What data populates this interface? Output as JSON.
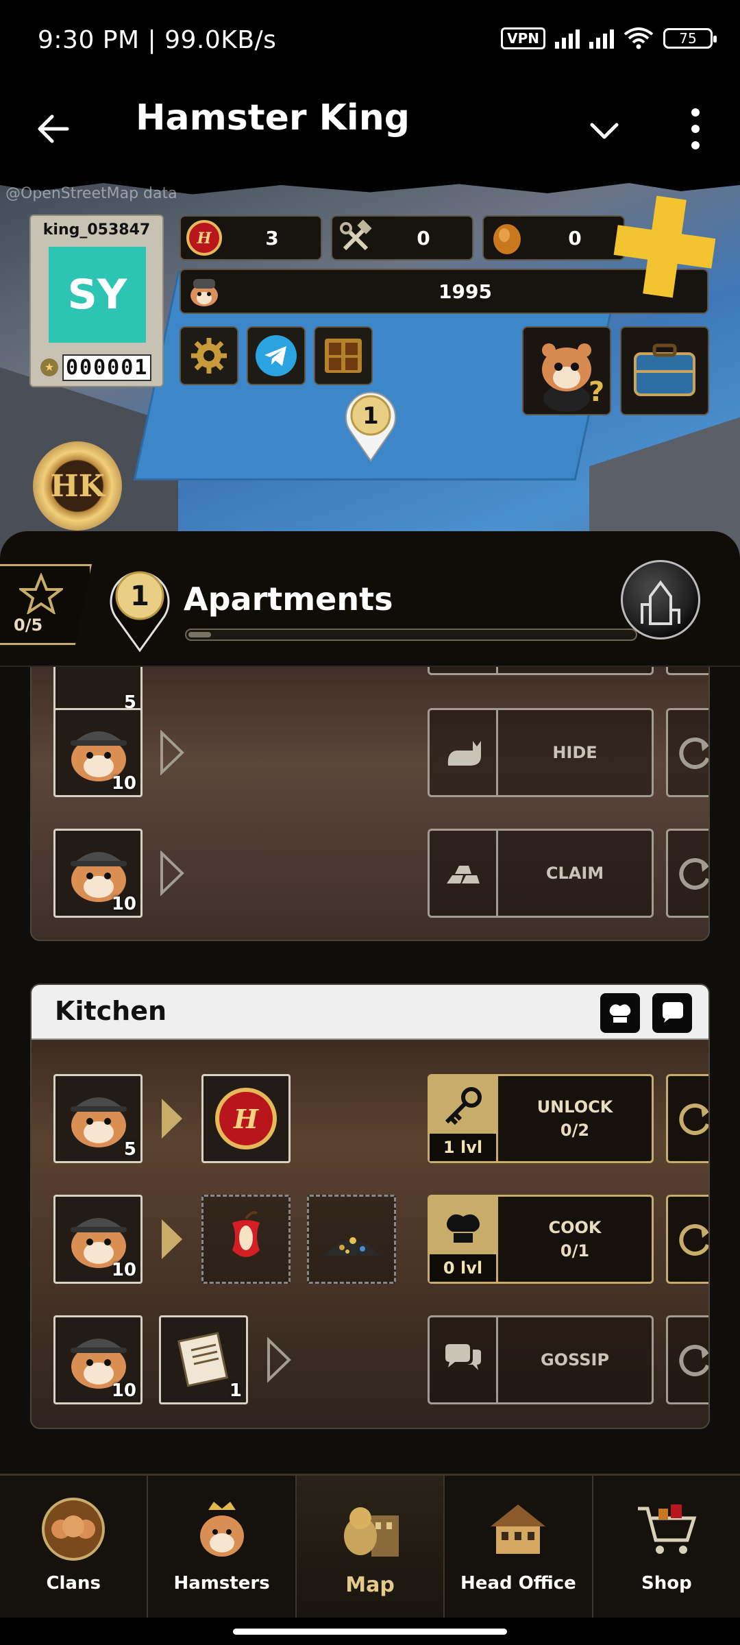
{
  "status_bar": {
    "time": "9:30 PM | 99.0KB/s",
    "vpn": "VPN",
    "battery": "75"
  },
  "app_bar": {
    "title": "Hamster King"
  },
  "map": {
    "attribution": "@OpenStreetMap data",
    "pin_number": "1"
  },
  "profile": {
    "username": "king_053847",
    "avatar_initials": "SY",
    "level_digits": "000001"
  },
  "resources": {
    "coins": "3",
    "tools": "0",
    "nuts": "0",
    "hamster_count": "1995"
  },
  "location": {
    "stars": "0/5",
    "pin_number": "1",
    "name": "Apartments",
    "progress_fraction": 0.05
  },
  "room1": {
    "rows": [
      {
        "hamster_count": "5"
      },
      {
        "hamster_count": "10",
        "action": "HIDE"
      },
      {
        "hamster_count": "10",
        "action": "CLAIM"
      }
    ]
  },
  "kitchen": {
    "title": "Kitchen",
    "rows": [
      {
        "hamster_count": "5",
        "action_title": "UNLOCK",
        "action_progress": "0/2",
        "level": "1 lvl"
      },
      {
        "hamster_count": "10",
        "action_title": "COOK",
        "action_progress": "0/1",
        "level": "0 lvl"
      },
      {
        "hamster_count": "10",
        "item_count": "1",
        "action_title": "GOSSIP"
      }
    ]
  },
  "nav": {
    "items": [
      {
        "label": "Clans"
      },
      {
        "label": "Hamsters"
      },
      {
        "label": "Map"
      },
      {
        "label": "Head Office"
      },
      {
        "label": "Shop"
      }
    ]
  },
  "colors": {
    "gold": "#c8ad6a",
    "teal_avatar": "#2ec4b3",
    "plus": "#f4c430"
  }
}
